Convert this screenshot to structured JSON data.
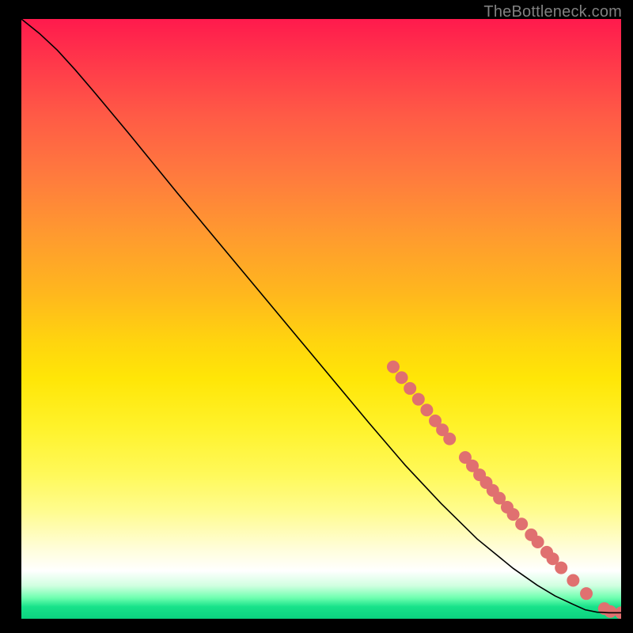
{
  "watermark": "TheBottleneck.com",
  "chart_data": {
    "type": "line",
    "title": "",
    "xlabel": "",
    "ylabel": "",
    "xlim": [
      0,
      100
    ],
    "ylim": [
      0,
      100
    ],
    "grid": false,
    "legend": null,
    "curve": {
      "name": "bottleneck-curve",
      "color": "#000000",
      "points": [
        {
          "x": 0.0,
          "y": 100.0
        },
        {
          "x": 3.0,
          "y": 97.6
        },
        {
          "x": 6.0,
          "y": 94.8
        },
        {
          "x": 9.0,
          "y": 91.5
        },
        {
          "x": 12.0,
          "y": 88.0
        },
        {
          "x": 18.0,
          "y": 80.8
        },
        {
          "x": 26.0,
          "y": 71.0
        },
        {
          "x": 34.0,
          "y": 61.4
        },
        {
          "x": 42.0,
          "y": 51.8
        },
        {
          "x": 50.0,
          "y": 42.2
        },
        {
          "x": 58.0,
          "y": 32.6
        },
        {
          "x": 64.0,
          "y": 25.6
        },
        {
          "x": 70.0,
          "y": 19.2
        },
        {
          "x": 76.0,
          "y": 13.3
        },
        {
          "x": 82.0,
          "y": 8.4
        },
        {
          "x": 86.0,
          "y": 5.6
        },
        {
          "x": 89.0,
          "y": 3.8
        },
        {
          "x": 92.0,
          "y": 2.4
        },
        {
          "x": 94.0,
          "y": 1.5
        },
        {
          "x": 96.0,
          "y": 1.1
        },
        {
          "x": 98.0,
          "y": 1.0
        },
        {
          "x": 100.0,
          "y": 1.0
        }
      ]
    },
    "markers": {
      "name": "highlighted-segment",
      "color": "#e07070",
      "radius_px": 8,
      "points": [
        {
          "x": 62.0,
          "y": 42.0
        },
        {
          "x": 63.4,
          "y": 40.2
        },
        {
          "x": 64.8,
          "y": 38.4
        },
        {
          "x": 66.2,
          "y": 36.6
        },
        {
          "x": 67.6,
          "y": 34.8
        },
        {
          "x": 69.0,
          "y": 33.0
        },
        {
          "x": 70.2,
          "y": 31.5
        },
        {
          "x": 71.4,
          "y": 30.0
        },
        {
          "x": 74.0,
          "y": 26.9
        },
        {
          "x": 75.2,
          "y": 25.5
        },
        {
          "x": 76.4,
          "y": 24.0
        },
        {
          "x": 77.5,
          "y": 22.7
        },
        {
          "x": 78.6,
          "y": 21.4
        },
        {
          "x": 79.7,
          "y": 20.1
        },
        {
          "x": 81.0,
          "y": 18.6
        },
        {
          "x": 82.0,
          "y": 17.4
        },
        {
          "x": 83.4,
          "y": 15.8
        },
        {
          "x": 85.0,
          "y": 14.0
        },
        {
          "x": 86.1,
          "y": 12.8
        },
        {
          "x": 87.6,
          "y": 11.1
        },
        {
          "x": 88.6,
          "y": 10.0
        },
        {
          "x": 90.0,
          "y": 8.5
        },
        {
          "x": 92.0,
          "y": 6.4
        },
        {
          "x": 94.2,
          "y": 4.2
        },
        {
          "x": 97.2,
          "y": 1.7
        },
        {
          "x": 98.2,
          "y": 1.2
        },
        {
          "x": 100.0,
          "y": 1.0
        }
      ]
    }
  }
}
